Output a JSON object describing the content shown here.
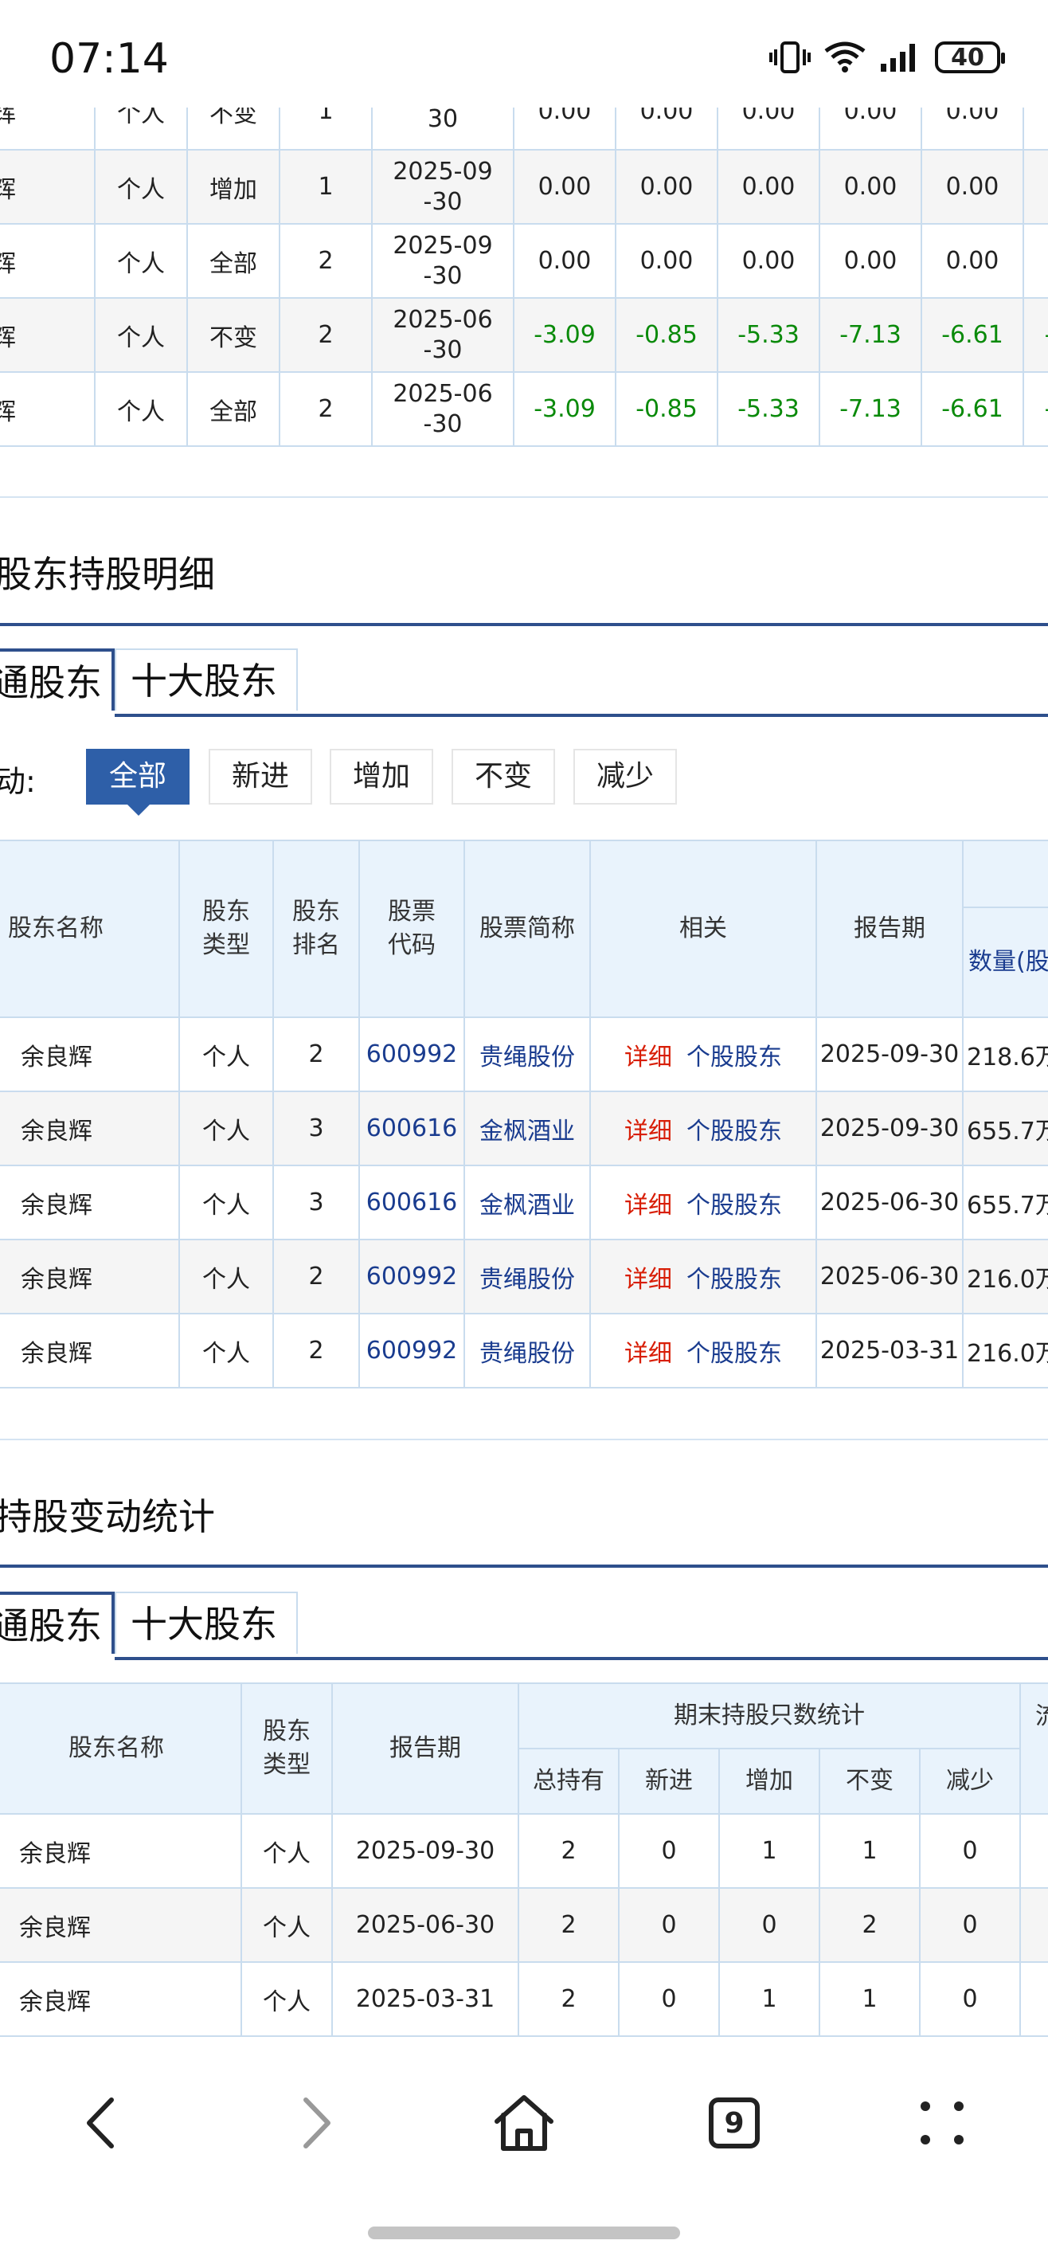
{
  "status_bar": {
    "time": "07:14",
    "battery": "40"
  },
  "top_table": {
    "rows": [
      {
        "name": "辉",
        "type": "个人",
        "change": "不变",
        "count": "1",
        "date": "30",
        "v": [
          "0.00",
          "0.00",
          "0.00",
          "0.00",
          "0.00"
        ],
        "partial": true
      },
      {
        "name": "辉",
        "type": "个人",
        "change": "增加",
        "count": "1",
        "date": "2025-09-30",
        "v": [
          "0.00",
          "0.00",
          "0.00",
          "0.00",
          "0.00"
        ]
      },
      {
        "name": "辉",
        "type": "个人",
        "change": "全部",
        "count": "2",
        "date": "2025-09-30",
        "v": [
          "0.00",
          "0.00",
          "0.00",
          "0.00",
          "0.00"
        ]
      },
      {
        "name": "辉",
        "type": "个人",
        "change": "不变",
        "count": "2",
        "date": "2025-06-30",
        "v": [
          "-3.09",
          "-0.85",
          "-5.33",
          "-7.13",
          "-6.61"
        ],
        "neg": true
      },
      {
        "name": "辉",
        "type": "个人",
        "change": "全部",
        "count": "2",
        "date": "2025-06-30",
        "v": [
          "-3.09",
          "-0.85",
          "-5.33",
          "-7.13",
          "-6.61"
        ],
        "neg": true
      }
    ]
  },
  "section2": {
    "title": "股东持股明细",
    "tabs": [
      "通股东",
      "十大股东"
    ],
    "filter_label": "动:",
    "filters": [
      "全部",
      "新进",
      "增加",
      "不变",
      "减少"
    ],
    "headers": [
      "股东名称",
      "股东类型",
      "股东排名",
      "股票代码",
      "股票简称",
      "相关",
      "报告期",
      "数量(股"
    ],
    "link_detail": "详细",
    "link_holders": "个股股东",
    "rows": [
      {
        "name": "余良辉",
        "type": "个人",
        "rank": "2",
        "code": "600992",
        "stock": "贵绳股份",
        "date": "2025-09-30",
        "qty": "218.6万"
      },
      {
        "name": "余良辉",
        "type": "个人",
        "rank": "3",
        "code": "600616",
        "stock": "金枫酒业",
        "date": "2025-09-30",
        "qty": "655.7万"
      },
      {
        "name": "余良辉",
        "type": "个人",
        "rank": "3",
        "code": "600616",
        "stock": "金枫酒业",
        "date": "2025-06-30",
        "qty": "655.7万"
      },
      {
        "name": "余良辉",
        "type": "个人",
        "rank": "2",
        "code": "600992",
        "stock": "贵绳股份",
        "date": "2025-06-30",
        "qty": "216.0万"
      },
      {
        "name": "余良辉",
        "type": "个人",
        "rank": "2",
        "code": "600992",
        "stock": "贵绳股份",
        "date": "2025-03-31",
        "qty": "216.0万"
      }
    ]
  },
  "section3": {
    "title": "持股变动统计",
    "tabs": [
      "通股东",
      "十大股东"
    ],
    "headers": {
      "name": "股东名称",
      "type": "股东类型",
      "date": "报告期",
      "group": "期末持股只数统计",
      "sub": [
        "总持有",
        "新进",
        "增加",
        "不变",
        "减少"
      ],
      "next": "流"
    },
    "rows": [
      {
        "name": "余良辉",
        "type": "个人",
        "date": "2025-09-30",
        "v": [
          "2",
          "0",
          "1",
          "1",
          "0"
        ]
      },
      {
        "name": "余良辉",
        "type": "个人",
        "date": "2025-06-30",
        "v": [
          "2",
          "0",
          "0",
          "2",
          "0"
        ]
      },
      {
        "name": "余良辉",
        "type": "个人",
        "date": "2025-03-31",
        "v": [
          "2",
          "0",
          "1",
          "1",
          "0"
        ]
      }
    ]
  },
  "bottom_nav": {
    "tab_count": "9",
    "icons": [
      "back-icon",
      "forward-icon",
      "home-icon",
      "tabs-icon",
      "menu-icon"
    ]
  }
}
